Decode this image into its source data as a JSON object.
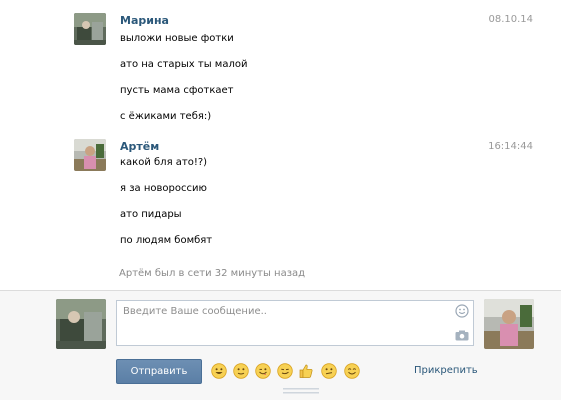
{
  "messages": [
    {
      "sender": "Марина",
      "time": "08.10.14",
      "lines": [
        "выложи новые фотки",
        "ато на старых ты малой",
        "пусть мама сфоткает",
        "с ёжиками тебя:)"
      ]
    },
    {
      "sender": "Артём",
      "time": "16:14:44",
      "lines": [
        "какой бля ато!?)",
        "я за новороссию",
        "ато пидары",
        "по людям бомбят"
      ]
    }
  ],
  "status_text": "Артём был в сети 32 минуты назад",
  "composer": {
    "placeholder": "Введите Ваше сообщение..",
    "send_label": "Отправить",
    "attach_label": "Прикрепить",
    "emoji_icons": [
      "smile-emoji-icon",
      "neutral-emoji-icon",
      "wink-emoji-icon",
      "smirk-emoji-icon",
      "thumbs-up-icon",
      "confused-emoji-icon",
      "happy-emoji-icon"
    ]
  },
  "colors": {
    "link": "#2b587a",
    "button": "#5b7fa6",
    "muted": "#999999"
  }
}
